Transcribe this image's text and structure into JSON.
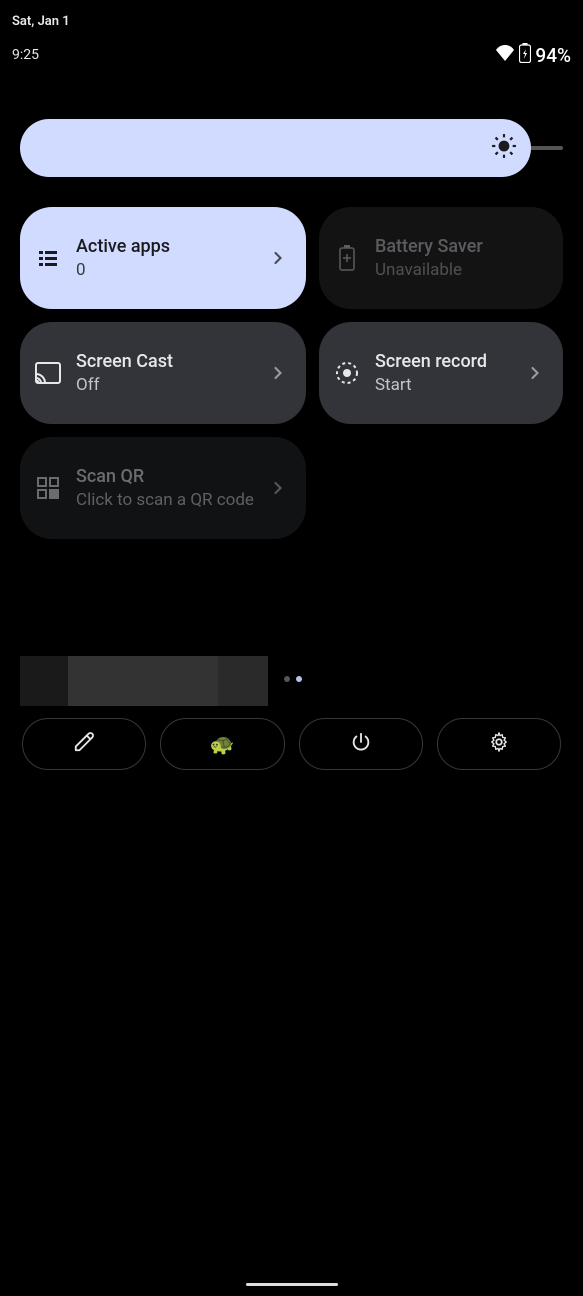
{
  "status": {
    "date": "Sat, Jan 1",
    "time": "9:25",
    "battery_percent": "94%"
  },
  "tiles": {
    "active_apps": {
      "title": "Active apps",
      "sub": "0"
    },
    "battery_saver": {
      "title": "Battery Saver",
      "sub": "Unavailable"
    },
    "screen_cast": {
      "title": "Screen Cast",
      "sub": "Off"
    },
    "screen_record": {
      "title": "Screen record",
      "sub": "Start"
    },
    "scan_qr": {
      "title": "Scan QR",
      "sub": "Click to scan a QR code"
    }
  },
  "icons": {
    "brightness": "brightness-icon",
    "wifi": "wifi-icon",
    "battery": "battery-charging-icon",
    "active_apps": "list-icon",
    "battery_saver": "battery-icon",
    "cast": "cast-icon",
    "record": "record-icon",
    "qr": "qr-icon",
    "edit": "edit-icon",
    "power": "power-icon",
    "settings": "gear-icon"
  }
}
